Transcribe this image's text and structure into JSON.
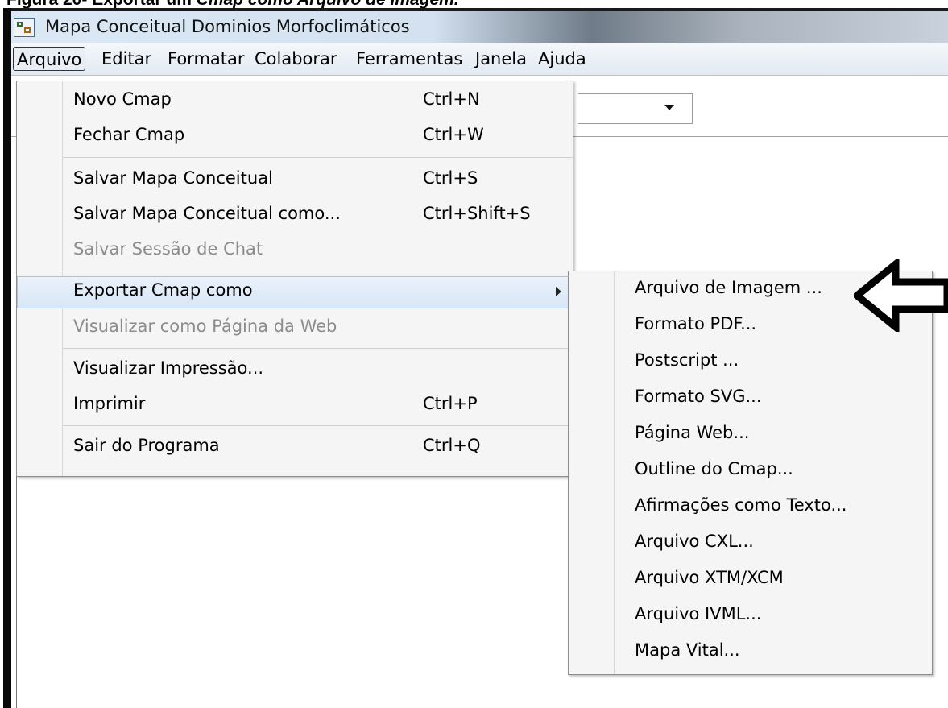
{
  "caption": {
    "prefix": "Figura 20- Exportar um ",
    "emph": "Cmap",
    "suffix": " como Arquivo de Imagem."
  },
  "window": {
    "title": "Mapa Conceitual Dominios Morfoclimáticos",
    "icon": "cmap-app-icon"
  },
  "menubar": {
    "items": [
      "Arquivo",
      "Editar",
      "Formatar",
      "Colaborar",
      "Ferramentas",
      "Janela",
      "Ajuda"
    ],
    "active": "Arquivo"
  },
  "file_menu": {
    "items": [
      {
        "label": "Novo Cmap",
        "shortcut": "Ctrl+N"
      },
      {
        "label": "Fechar Cmap",
        "shortcut": "Ctrl+W"
      },
      {
        "label": "Salvar Mapa Conceitual",
        "shortcut": "Ctrl+S"
      },
      {
        "label": "Salvar Mapa Conceitual como...",
        "shortcut": "Ctrl+Shift+S"
      },
      {
        "label": "Salvar Sessão de Chat",
        "shortcut": "",
        "disabled": true
      },
      {
        "label": "Exportar Cmap como",
        "shortcut": "",
        "submenu": true,
        "highlighted": true
      },
      {
        "label": "Visualizar como Página da Web",
        "shortcut": "",
        "disabled": true
      },
      {
        "label": "Visualizar Impressão...",
        "shortcut": ""
      },
      {
        "label": "Imprimir",
        "shortcut": "Ctrl+P"
      },
      {
        "label": "Sair do Programa",
        "shortcut": "Ctrl+Q"
      }
    ]
  },
  "export_submenu": {
    "items": [
      "Arquivo de Imagem ...",
      "Formato PDF...",
      "Postscript ...",
      "Formato SVG...",
      "Página Web...",
      "Outline do Cmap...",
      "Afirmações como Texto...",
      "Arquivo CXL...",
      "Arquivo XTM/XCM",
      "Arquivo IVML...",
      "Mapa Vital..."
    ]
  },
  "annotation": {
    "icon": "left-pointing-arrow-icon"
  },
  "colors": {
    "menu_bg": "#f5f5f5",
    "highlight": "#d8e6f6",
    "disabled_text": "#8c8c8c"
  }
}
